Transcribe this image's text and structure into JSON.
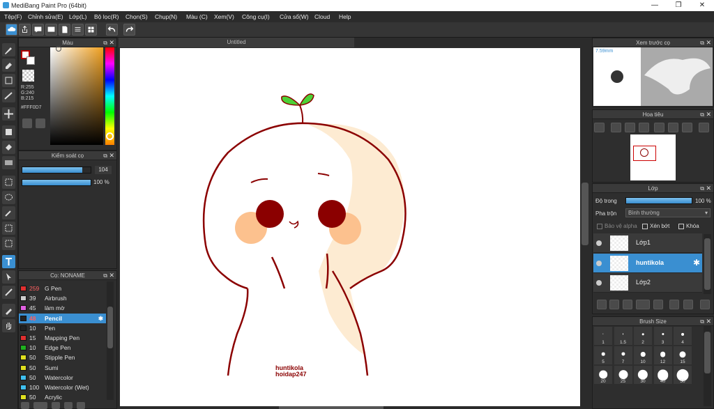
{
  "window": {
    "title": "MediBang Paint Pro (64bit)",
    "minimize": "—",
    "maximize": "❐",
    "close": "✕"
  },
  "menu": [
    "Tệp(F)",
    "Chỉnh sửa(E)",
    "Lớp(L)",
    "Bộ lọc(R)",
    "Chọn(S)",
    "Chụp(N)",
    "Màu (C)",
    "Xem(V)",
    "Công cụ(I)",
    "Cửa sổ(W)",
    "Cloud",
    "Help"
  ],
  "color_panel": {
    "title": "Màu",
    "r": "R:255",
    "g": "G:240",
    "b": "B:215",
    "hex": "#FFF0D7",
    "primary_color": "#FFF0D7",
    "accent": "#b00000"
  },
  "brush_control": {
    "title": "Kiểm soát cọ",
    "size": "104",
    "opacity": "100 %"
  },
  "brush_panel": {
    "title": "Cọ: NONAME",
    "items": [
      {
        "size": "259",
        "name": "G Pen",
        "color": "#e03030",
        "size_red": true
      },
      {
        "size": "39",
        "name": "Airbrush",
        "color": "#cccccc"
      },
      {
        "size": "45",
        "name": "làm mờ",
        "color": "#e060e0"
      },
      {
        "size": "48",
        "name": "Pencil",
        "color": "#222222",
        "selected": true,
        "size_red": true
      },
      {
        "size": "10",
        "name": "Pen",
        "color": "#222222"
      },
      {
        "size": "15",
        "name": "Mapping Pen",
        "color": "#e03030"
      },
      {
        "size": "10",
        "name": "Edge Pen",
        "color": "#20b020"
      },
      {
        "size": "50",
        "name": "Stipple Pen",
        "color": "#e0e020"
      },
      {
        "size": "50",
        "name": "Sumi",
        "color": "#e0e020"
      },
      {
        "size": "50",
        "name": "Watercolor",
        "color": "#40c0f0"
      },
      {
        "size": "100",
        "name": "Watercolor (Wet)",
        "color": "#40c0f0"
      },
      {
        "size": "50",
        "name": "Acrylic",
        "color": "#e0e020"
      }
    ]
  },
  "document": {
    "tab": "Untitled",
    "watermark_line1": "huntikola",
    "watermark_line2": "hoidap247"
  },
  "preview_panel": {
    "title": "Xem trước cọ",
    "size_label": "7.59mm"
  },
  "navigator_panel": {
    "title": "Hoa tiêu"
  },
  "layer_panel": {
    "title": "Lớp",
    "opacity_label": "Độ trong",
    "opacity_value": "100 %",
    "blend_label": "Pha trộn",
    "blend_value": "Bình thường",
    "protect_alpha": "Bảo vệ alpha",
    "clipping": "Xén bớt",
    "lock": "Khóa",
    "layers": [
      {
        "name": "Lớp1"
      },
      {
        "name": "huntikola",
        "selected": true
      },
      {
        "name": "Lớp2"
      }
    ]
  },
  "brush_size_panel": {
    "title": "Brush Size",
    "sizes": [
      "1",
      "1.5",
      "2",
      "3",
      "4",
      "5",
      "7",
      "10",
      "12",
      "15",
      "20",
      "25",
      "30",
      "40",
      "50"
    ]
  }
}
